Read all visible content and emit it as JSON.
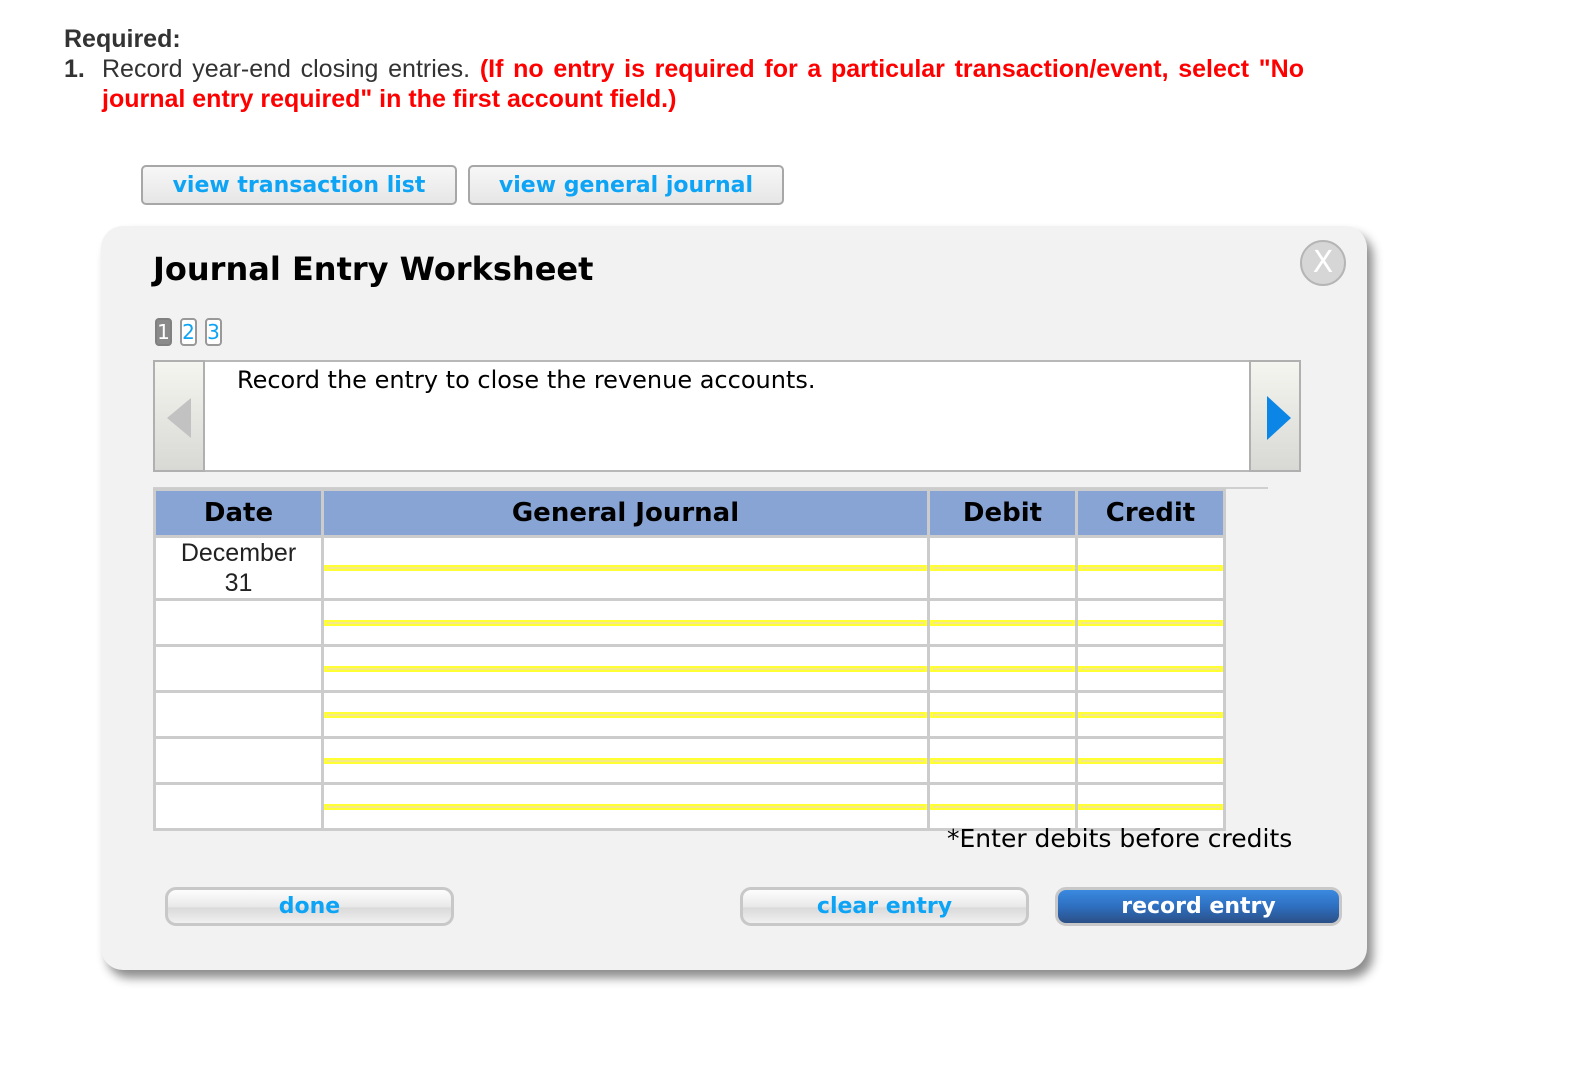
{
  "question": {
    "required_label": "Required:",
    "number": "1.",
    "text": "Record year-end closing entries.",
    "instruction": "(If no entry is required for a particular transaction/event, select \"No journal entry required\" in the first account field.)"
  },
  "top_buttons": {
    "transaction_list": "view transaction list",
    "general_journal": "view general journal"
  },
  "worksheet": {
    "title": "Journal Entry Worksheet",
    "close_label": "X",
    "pages": [
      {
        "label": "1",
        "active": true
      },
      {
        "label": "2",
        "active": false
      },
      {
        "label": "3",
        "active": false
      }
    ],
    "instruction_text": "Record the entry to close the revenue accounts.",
    "table": {
      "headers": [
        "Date",
        "General Journal",
        "Debit",
        "Credit"
      ],
      "rows": [
        {
          "date": "December 31",
          "account": "",
          "debit": "",
          "credit": ""
        },
        {
          "date": "",
          "account": "",
          "debit": "",
          "credit": ""
        },
        {
          "date": "",
          "account": "",
          "debit": "",
          "credit": ""
        },
        {
          "date": "",
          "account": "",
          "debit": "",
          "credit": ""
        },
        {
          "date": "",
          "account": "",
          "debit": "",
          "credit": ""
        },
        {
          "date": "",
          "account": "",
          "debit": "",
          "credit": ""
        }
      ]
    },
    "note": "*Enter debits before credits",
    "buttons": {
      "done": "done",
      "clear": "clear entry",
      "record": "record entry"
    }
  },
  "colors": {
    "accent_blue_text": "#0da4f5",
    "header_blue": "#88a4d4",
    "input_highlight": "#ffff33",
    "instruction_red": "#ff0000",
    "primary_button": "#2e6fc0"
  }
}
